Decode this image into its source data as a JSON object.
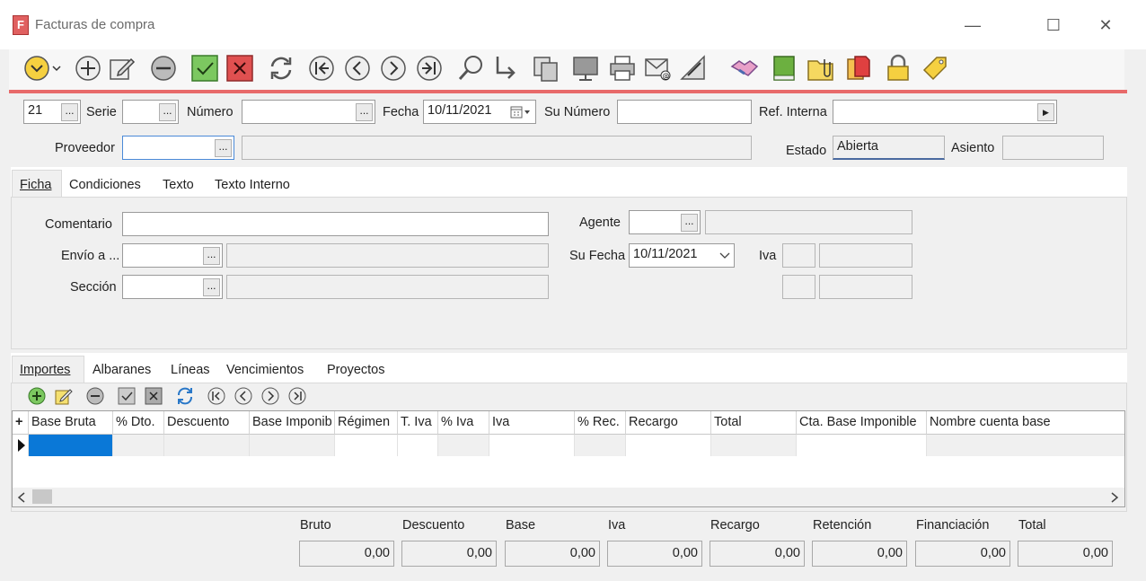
{
  "window": {
    "title": "Facturas de compra",
    "app_icon_letter": "F"
  },
  "header": {
    "id_value": "21",
    "serie_label": "Serie",
    "numero_label": "Número",
    "fecha_label": "Fecha",
    "fecha_value": "10/11/2021",
    "su_numero_label": "Su Número",
    "ref_interna_label": "Ref. Interna",
    "proveedor_label": "Proveedor",
    "estado_label": "Estado",
    "estado_value": "Abierta",
    "asiento_label": "Asiento",
    "dots": "..."
  },
  "tabs_top": [
    "Ficha",
    "Condiciones",
    "Texto",
    "Texto Interno"
  ],
  "ficha": {
    "comentario_label": "Comentario",
    "envio_label": "Envío a ...",
    "seccion_label": "Sección",
    "agente_label": "Agente",
    "su_fecha_label": "Su Fecha",
    "su_fecha_value": "10/11/2021",
    "iva_label": "Iva"
  },
  "tabs_bottom": [
    "Importes",
    "Albaranes",
    "Líneas",
    "Vencimientos",
    "Proyectos"
  ],
  "grid": {
    "columns": [
      "Base Bruta",
      "% Dto.",
      "Descuento",
      "Base Imponib",
      "Régimen",
      "T. Iva",
      "% Iva",
      "Iva",
      "% Rec.",
      "Recargo",
      "Total",
      "Cta. Base Imponible",
      "Nombre cuenta base"
    ],
    "add_glyph": "+"
  },
  "totals": [
    {
      "label": "Bruto",
      "value": "0,00"
    },
    {
      "label": "Descuento",
      "value": "0,00"
    },
    {
      "label": "Base",
      "value": "0,00"
    },
    {
      "label": "Iva",
      "value": "0,00"
    },
    {
      "label": "Recargo",
      "value": "0,00"
    },
    {
      "label": "Retención",
      "value": "0,00"
    },
    {
      "label": "Financiación",
      "value": "0,00"
    },
    {
      "label": "Total",
      "value": "0,00"
    }
  ],
  "colors": {
    "accent_line": "#e86a6a",
    "selected_cell": "#0a78d7",
    "add_green": "#5cb85c",
    "cancel_red": "#e05050"
  }
}
